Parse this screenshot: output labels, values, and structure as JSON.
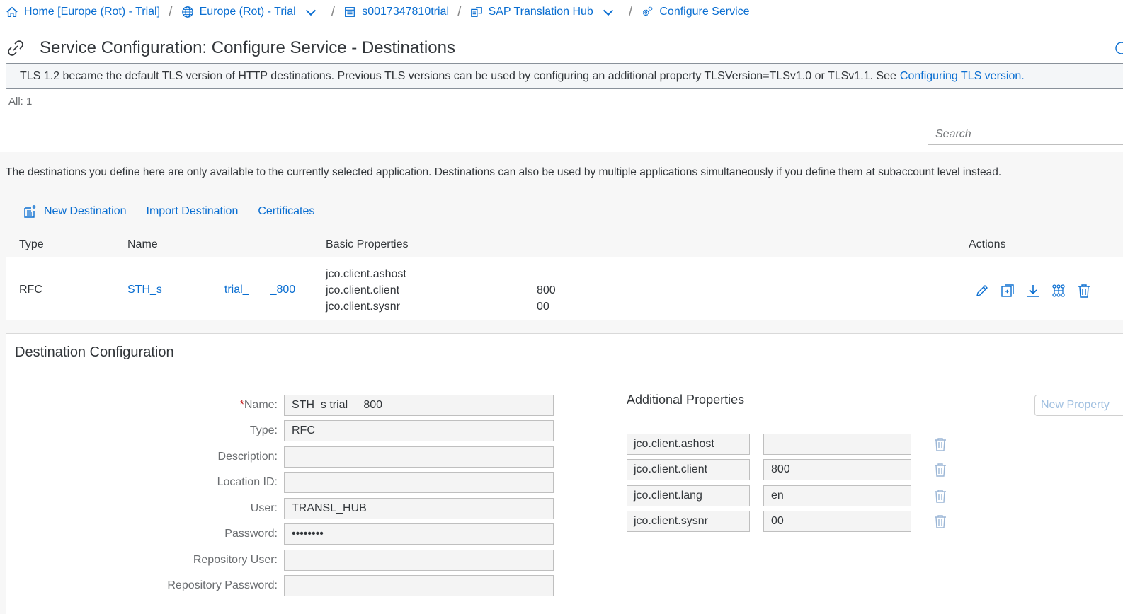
{
  "breadcrumb": [
    {
      "label": "Home [Europe (Rot) - Trial]",
      "icon": "home-icon"
    },
    {
      "label": "Europe (Rot) - Trial",
      "icon": "globe-icon",
      "dropdown": true
    },
    {
      "label": "s0017347810trial",
      "icon": "subaccount-icon"
    },
    {
      "label": "SAP Translation Hub",
      "icon": "service-icon",
      "dropdown": true
    },
    {
      "label": "Configure Service",
      "icon": "gears-icon"
    }
  ],
  "page": {
    "title": "Service Configuration: Configure Service - Destinations"
  },
  "info": {
    "message": "TLS 1.2 became the default TLS version of HTTP destinations. Previous TLS versions can be used by configuring an additional property TLSVersion=TLSv1.0 or TLSv1.1. See",
    "link": "Configuring TLS version."
  },
  "count": "All: 1",
  "search": {
    "placeholder": "Search"
  },
  "description": "The destinations you define here are only available to the currently selected application. Destinations can also be used by multiple applications simultaneously if you define them at subaccount level instead.",
  "toolbar": {
    "new_destination": "New Destination",
    "import_destination": "Import Destination",
    "certificates": "Certificates"
  },
  "table": {
    "headers": {
      "type": "Type",
      "name": "Name",
      "basic": "Basic Properties",
      "actions": "Actions"
    },
    "row": {
      "type": "RFC",
      "name_part1": "STH_s",
      "name_part2": "trial_",
      "name_part3": "_800",
      "props": [
        {
          "key": "jco.client.ashost",
          "value": ""
        },
        {
          "key": "jco.client.client",
          "value": "800"
        },
        {
          "key": "jco.client.sysnr",
          "value": "00"
        }
      ]
    }
  },
  "destination_config": {
    "title": "Destination Configuration",
    "fields": [
      {
        "label": "Name:",
        "value": "STH_s                    trial_         _800",
        "required": true
      },
      {
        "label": "Type:",
        "value": "RFC"
      },
      {
        "label": "Description:",
        "value": ""
      },
      {
        "label": "Location ID:",
        "value": ""
      },
      {
        "label": "User:",
        "value": "TRANSL_HUB"
      },
      {
        "label": "Password:",
        "value": "••••••••"
      },
      {
        "label": "Repository User:",
        "value": ""
      },
      {
        "label": "Repository Password:",
        "value": ""
      }
    ],
    "additional_title": "Additional Properties",
    "new_property": "New Property",
    "additional": [
      {
        "key": "jco.client.ashost",
        "value": ""
      },
      {
        "key": "jco.client.client",
        "value": "800"
      },
      {
        "key": "jco.client.lang",
        "value": "en"
      },
      {
        "key": "jco.client.sysnr",
        "value": "00"
      }
    ]
  }
}
